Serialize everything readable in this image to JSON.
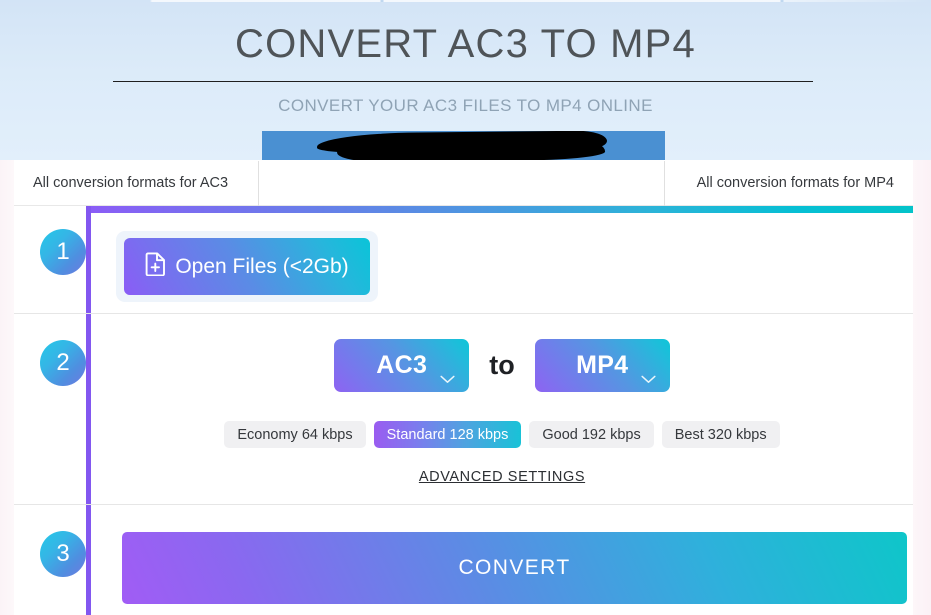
{
  "header": {
    "title": "CONVERT AC3 TO MP4",
    "subtitle": "CONVERT YOUR AC3 FILES TO MP4 ONLINE",
    "banner_color": "#4a90d2"
  },
  "tabs": [
    {
      "label": "All conversion formats for AC3"
    },
    {
      "label": ""
    },
    {
      "label": "All conversion formats for MP4"
    }
  ],
  "steps": {
    "one": {
      "number": "1",
      "open_files_label": "Open Files (<2Gb)",
      "file_icon": "file-plus-icon"
    },
    "two": {
      "number": "2",
      "source_format": "AC3",
      "target_format": "MP4",
      "to_label": "to",
      "chevron_icon": "chevron-down-icon",
      "bitrates": [
        {
          "label": "Economy 64 kbps",
          "selected": false
        },
        {
          "label": "Standard 128 kbps",
          "selected": true
        },
        {
          "label": "Good 192 kbps",
          "selected": false
        },
        {
          "label": "Best 320 kbps",
          "selected": false
        }
      ],
      "advanced_settings_label": "ADVANCED SETTINGS"
    },
    "three": {
      "number": "3",
      "convert_label": "CONVERT"
    }
  },
  "colors": {
    "gradient_start": "#8b5cf6",
    "gradient_end": "#04c3c9",
    "accent_line": "#8257f0",
    "header_bg": "#d9e9f8"
  }
}
